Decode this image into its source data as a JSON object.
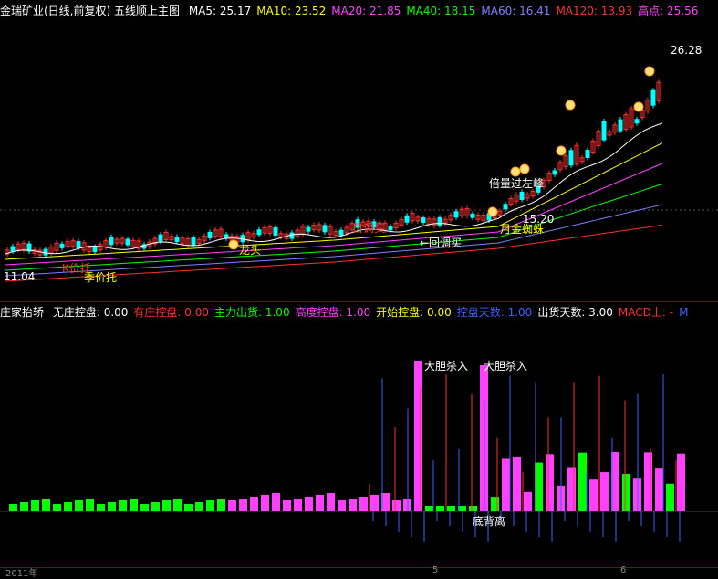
{
  "main": {
    "title": "金瑞矿业(日线,前复权) 五线顺上主图",
    "indicators": [
      {
        "label": "MA5: 25.17",
        "color": "#ffffff"
      },
      {
        "label": "MA10: 23.52",
        "color": "#ffff00"
      },
      {
        "label": "MA20: 21.85",
        "color": "#ff40ff"
      },
      {
        "label": "MA40: 18.15",
        "color": "#00ff00"
      },
      {
        "label": "MA60: 16.41",
        "color": "#8080ff"
      },
      {
        "label": "MA120: 13.93",
        "color": "#ff3030"
      },
      {
        "label": "高点: 25.56",
        "color": "#ff40ff"
      }
    ],
    "annotations": {
      "high_price": "26.28",
      "low_price": "11.04",
      "mid_price": "15.20",
      "double_volume": "倍量过左峰",
      "moon_gold": "月金蜘蛛",
      "pullback": "←回调买",
      "dragon_head": "龙头",
      "price_support": "季价托",
      "daily_pullback": "日调买",
      "k_support": "K价托"
    },
    "colors": {
      "up": "#ff3030",
      "down": "#00ffff",
      "grid": "#8b0000"
    }
  },
  "sub": {
    "title": "庄家抬轿",
    "indicators": [
      {
        "label": "无庄控盘: 0.00",
        "color": "#ffffff"
      },
      {
        "label": "有庄控盘: 0.00",
        "color": "#ff3030"
      },
      {
        "label": "主力出货: 1.00",
        "color": "#00ff00"
      },
      {
        "label": "高度控盘: 1.00",
        "color": "#ff40ff"
      },
      {
        "label": "开始控盘: 0.00",
        "color": "#ffff00"
      },
      {
        "label": "控盘天数: 1.00",
        "color": "#4060ff"
      },
      {
        "label": "出货天数: 3.00",
        "color": "#ffffff"
      },
      {
        "label": "MACD上: -",
        "color": "#ff3030"
      },
      {
        "label": "M",
        "color": "#4060ff"
      }
    ],
    "annotations": {
      "kill_in_1": "大胆杀入",
      "kill_in_2": "大胆杀入",
      "bottom_divergence": "底背离"
    }
  },
  "axis": {
    "year_label": "2011年",
    "mark_5": "5",
    "mark_6": "6"
  }
}
